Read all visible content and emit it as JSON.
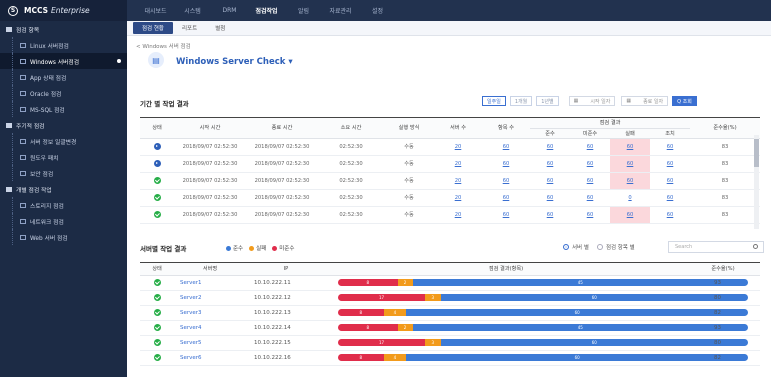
{
  "brand": {
    "name": "MCCS",
    "edition": "Enterprise"
  },
  "topnav": [
    "대시보드",
    "시스템",
    "DRM",
    "점검작업",
    "알림",
    "자료관리",
    "설정"
  ],
  "topnav_active": 3,
  "subtabs": [
    "점검 현황",
    "리포트",
    "별첨"
  ],
  "subtabs_active": 0,
  "sidebar": [
    {
      "label": "점검 항목",
      "type": "group"
    },
    {
      "label": "Linux 서버점검",
      "type": "sub"
    },
    {
      "label": "Windows 서버점검",
      "type": "sub",
      "active": true
    },
    {
      "label": "App 상태 점검",
      "type": "sub"
    },
    {
      "label": "Oracle 점검",
      "type": "sub"
    },
    {
      "label": "MS-SQL 점검",
      "type": "sub"
    },
    {
      "label": "주기적 점검",
      "type": "group"
    },
    {
      "label": "서버 정보 일괄변경",
      "type": "sub"
    },
    {
      "label": "원도우 패치",
      "type": "sub"
    },
    {
      "label": "보안 점검",
      "type": "sub"
    },
    {
      "label": "개별 점검 작업",
      "type": "group"
    },
    {
      "label": "스토리지 점검",
      "type": "sub"
    },
    {
      "label": "네트워크 점검",
      "type": "sub"
    },
    {
      "label": "Web 서버 점검",
      "type": "sub"
    }
  ],
  "breadcrumb": "< Windows 서버 점검",
  "page_title": "Windows Server Check",
  "period_section": {
    "title": "기간 별 작업 결과",
    "filters": [
      "일주일",
      "1개월",
      "1년별"
    ],
    "filter_active": 0,
    "start_label": "시작 일자",
    "end_label": "종료 일자",
    "search_label": "Q 조회",
    "columns": [
      "상태",
      "시작 시간",
      "종료 시간",
      "소요 시간",
      "실행 방식",
      "서버 수",
      "항목 수",
      "점검 결과",
      "준수율(%)"
    ],
    "subcolumns": [
      "준수",
      "미준수",
      "실패",
      "조치"
    ],
    "rows": [
      {
        "status": "play",
        "start": "2018/09/07 02:52:30",
        "end": "2018/09/07 02:52:30",
        "elapsed": "02:52:30",
        "mode": "수동",
        "servers": "20",
        "items": "60",
        "ok": "60",
        "ng": "60",
        "fail": "60",
        "act": "60",
        "rate": "83",
        "fail_hi": true
      },
      {
        "status": "play",
        "start": "2018/09/07 02:52:30",
        "end": "2018/09/07 02:52:30",
        "elapsed": "02:52:30",
        "mode": "수동",
        "servers": "20",
        "items": "60",
        "ok": "60",
        "ng": "60",
        "fail": "60",
        "act": "60",
        "rate": "83",
        "fail_hi": true
      },
      {
        "status": "ok",
        "start": "2018/09/07 02:52:30",
        "end": "2018/09/07 02:52:30",
        "elapsed": "02:52:30",
        "mode": "수동",
        "servers": "20",
        "items": "60",
        "ok": "60",
        "ng": "60",
        "fail": "60",
        "act": "60",
        "rate": "83",
        "fail_hi": true
      },
      {
        "status": "ok",
        "start": "2018/09/07 02:52:30",
        "end": "2018/09/07 02:52:30",
        "elapsed": "02:52:30",
        "mode": "수동",
        "servers": "20",
        "items": "60",
        "ok": "60",
        "ng": "60",
        "fail": "0",
        "act": "60",
        "rate": "83",
        "fail_hi": false
      },
      {
        "status": "ok",
        "start": "2018/09/07 02:52:30",
        "end": "2018/09/07 02:52:30",
        "elapsed": "02:52:30",
        "mode": "수동",
        "servers": "20",
        "items": "60",
        "ok": "60",
        "ng": "60",
        "fail": "60",
        "act": "60",
        "rate": "83",
        "fail_hi": true
      }
    ]
  },
  "server_section": {
    "title": "서버별 작업 결과",
    "legend": [
      {
        "label": "준수",
        "color": "#3b7ad6"
      },
      {
        "label": "실패",
        "color": "#f29b1c"
      },
      {
        "label": "미준수",
        "color": "#e02d4b"
      }
    ],
    "radios": [
      "서버 별",
      "점검 항목 별"
    ],
    "radio_selected": 0,
    "search_placeholder": "Search",
    "columns": [
      "상태",
      "서버명",
      "IP",
      "점검 결과(항목)",
      "준수율(%)"
    ],
    "rows": [
      {
        "name": "Server1",
        "ip": "10.10.222.11",
        "red": 8,
        "orange": 2,
        "blue": 45,
        "rate": "93"
      },
      {
        "name": "Server2",
        "ip": "10.10.222.12",
        "red": 17,
        "orange": 3,
        "blue": 60,
        "rate": "80"
      },
      {
        "name": "Server3",
        "ip": "10.10.222.13",
        "red": 8,
        "orange": 4,
        "blue": 60,
        "rate": "82"
      },
      {
        "name": "Server4",
        "ip": "10.10.222.14",
        "red": 8,
        "orange": 2,
        "blue": 45,
        "rate": "93"
      },
      {
        "name": "Server5",
        "ip": "10.10.222.15",
        "red": 17,
        "orange": 3,
        "blue": 60,
        "rate": "80"
      },
      {
        "name": "Server6",
        "ip": "10.10.222.16",
        "red": 8,
        "orange": 4,
        "blue": 60,
        "rate": "82"
      }
    ]
  }
}
